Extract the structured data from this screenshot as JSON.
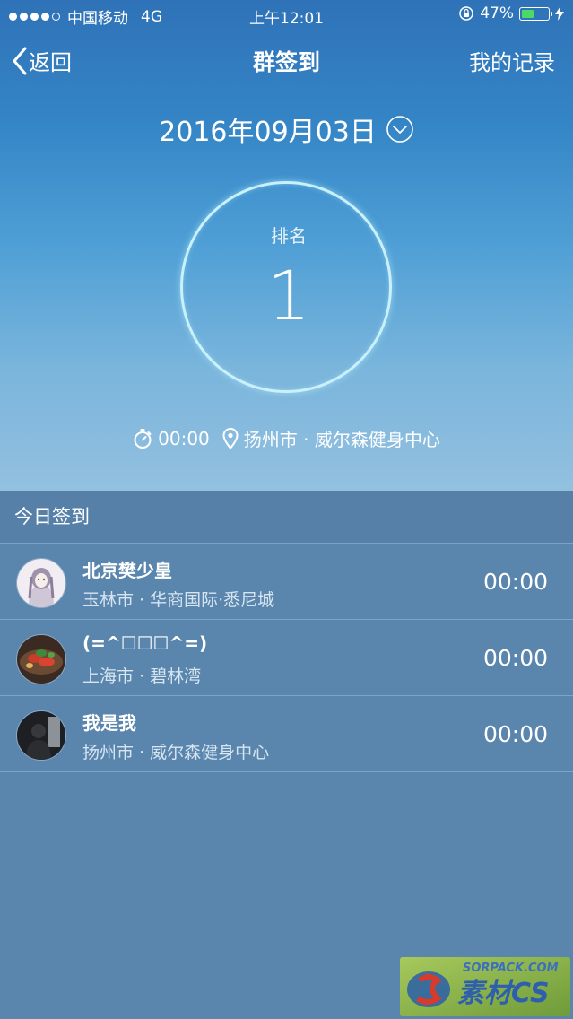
{
  "status_bar": {
    "carrier": "中国移动",
    "network": "4G",
    "time": "上午12:01",
    "battery_percent": "47%",
    "battery_level": 0.47,
    "signal_bars_filled": 4
  },
  "nav": {
    "back_label": "返回",
    "title": "群签到",
    "records_label": "我的记录"
  },
  "date": "2016年09月03日",
  "rank": {
    "label": "排名",
    "value": "1"
  },
  "checkin_info": {
    "time": "00:00",
    "location": "扬州市 · 威尔森健身中心"
  },
  "section_title": "今日签到",
  "checkins": [
    {
      "name": "北京樊少皇",
      "location": "玉林市 · 华商国际·悉尼城",
      "time": "00:00",
      "avatar": "anime-girl-avatar"
    },
    {
      "name": "(=^☐☐☐^=)",
      "location": "上海市 · 碧林湾",
      "time": "00:00",
      "avatar": "food-avatar"
    },
    {
      "name": "我是我",
      "location": "扬州市 · 威尔森健身中心",
      "time": "00:00",
      "avatar": "silhouette-avatar"
    }
  ],
  "watermark": {
    "top_text": "SORPACK.COM",
    "main_text": "素材CS"
  },
  "colors": {
    "accent_ring": "#c9f1fb",
    "list_bg": "#5a86ad",
    "battery_green": "#4cd964"
  }
}
